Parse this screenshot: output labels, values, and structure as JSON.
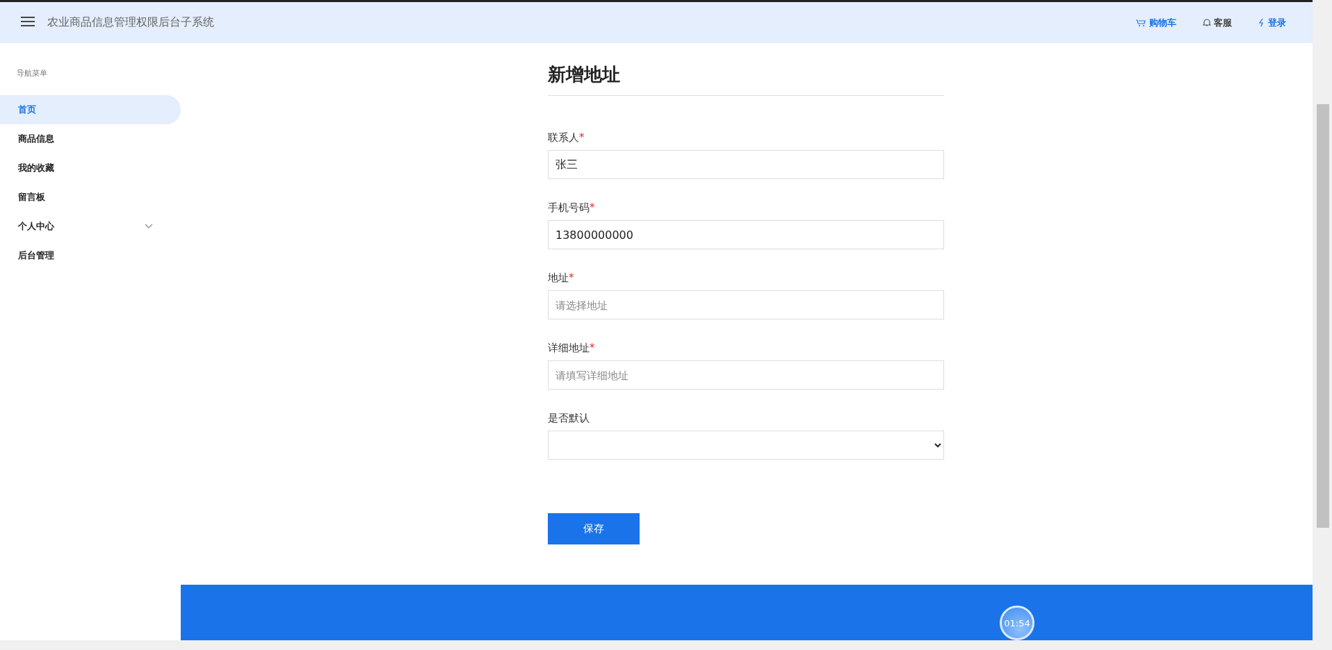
{
  "header": {
    "title": "农业商品信息管理权限后台子系统",
    "links": [
      {
        "label": "购物车",
        "kind": "cart"
      },
      {
        "label": "客服",
        "kind": "service"
      },
      {
        "label": "登录",
        "kind": "login"
      }
    ]
  },
  "sidebar": {
    "heading": "导航菜单",
    "items": [
      {
        "label": "首页",
        "selected": true
      },
      {
        "label": "商品信息",
        "selected": false
      },
      {
        "label": "我的收藏",
        "selected": false
      },
      {
        "label": "留言板",
        "selected": false
      },
      {
        "label": "个人中心",
        "selected": false,
        "expandable": true
      },
      {
        "label": "后台管理",
        "selected": false
      }
    ]
  },
  "form": {
    "title": "新增地址",
    "fields": [
      {
        "label": "联系人",
        "required_mark": "*",
        "kind": "text",
        "value": "张三"
      },
      {
        "label": "手机号码",
        "required_mark": "*",
        "kind": "text",
        "value": "13800000000"
      },
      {
        "label": "地址",
        "required_mark": "*",
        "kind": "text",
        "placeholder": "请选择地址"
      },
      {
        "label": "详细地址",
        "required_mark": "*",
        "kind": "text",
        "placeholder": "请填写详细地址"
      },
      {
        "label": "是否默认",
        "kind": "select"
      }
    ],
    "submit": "保存"
  },
  "timer": "01:54"
}
